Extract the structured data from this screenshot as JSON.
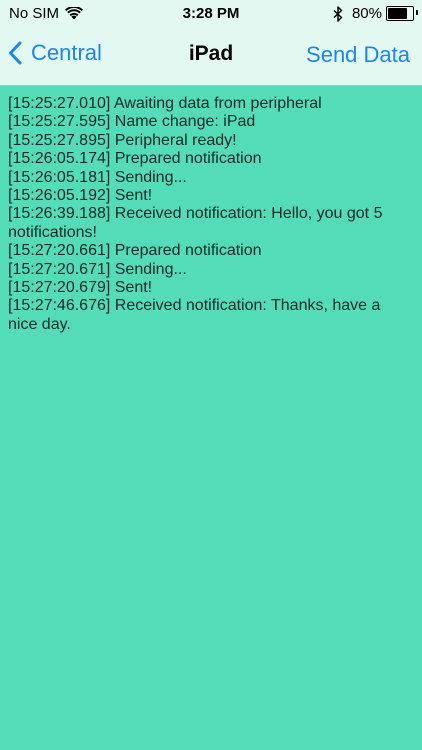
{
  "status_bar": {
    "carrier": "No SIM",
    "time": "3:28 PM",
    "battery_percent": "80%",
    "battery_level": 0.8,
    "icons": [
      "wifi-icon",
      "bluetooth-icon",
      "battery-icon"
    ]
  },
  "nav": {
    "back_label": "Central",
    "title": "iPad",
    "action_label": "Send Data",
    "accent_color": "#1a86f0"
  },
  "colors": {
    "background": "#54dcb9",
    "nav_background": "#e2f8f1"
  },
  "log": [
    "[15:25:27.010] Awaiting data from peripheral",
    "[15:25:27.595] Name change: iPad",
    "[15:25:27.895] Peripheral ready!",
    "[15:26:05.174] Prepared notification",
    "[15:26:05.181] Sending...",
    "[15:26:05.192] Sent!",
    "[15:26:39.188] Received notification: Hello, you got 5 notifications!",
    "[15:27:20.661] Prepared notification",
    "[15:27:20.671] Sending...",
    "[15:27:20.679] Sent!",
    "[15:27:46.676] Received notification: Thanks, have a nice day."
  ]
}
